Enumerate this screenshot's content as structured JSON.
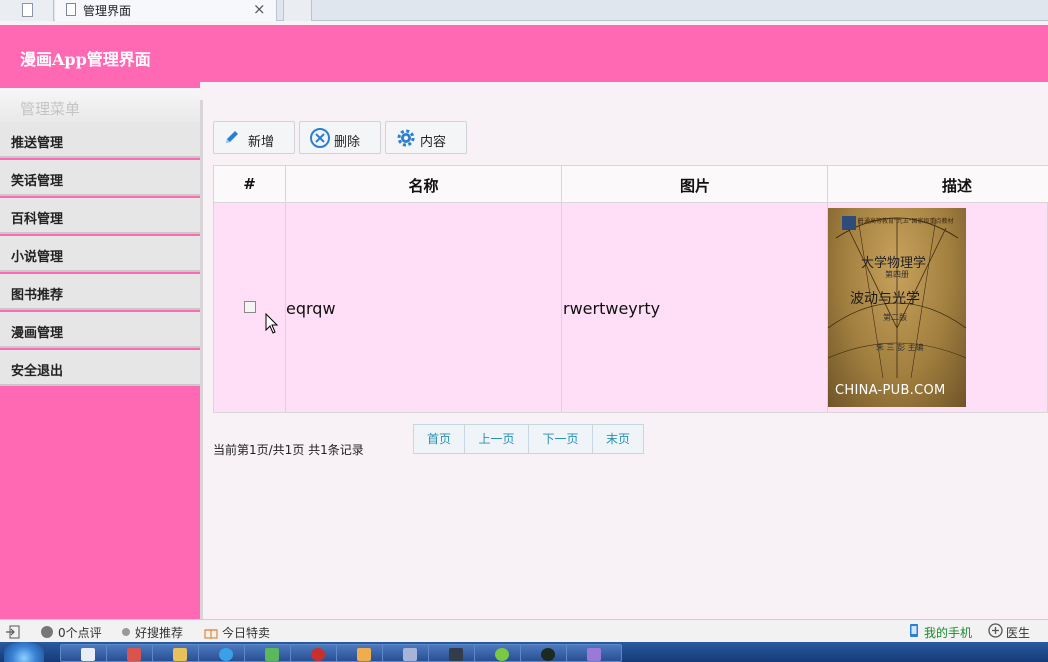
{
  "browser": {
    "tab_title": "管理界面",
    "close_glyph": "×"
  },
  "header": {
    "title": "漫画App管理界面"
  },
  "sidebar": {
    "heading": "管理菜单",
    "items": [
      {
        "label": "推送管理"
      },
      {
        "label": "笑话管理"
      },
      {
        "label": "百科管理"
      },
      {
        "label": "小说管理"
      },
      {
        "label": "图书推荐"
      },
      {
        "label": "漫画管理"
      },
      {
        "label": "安全退出"
      }
    ]
  },
  "toolbar": {
    "add_label": "新增",
    "delete_label": "删除",
    "content_label": "内容"
  },
  "table": {
    "columns": [
      "#",
      "名称",
      "图片",
      "描述"
    ],
    "rows": [
      {
        "name": "eqrqw",
        "image": "rwertweyrty"
      }
    ]
  },
  "book_cover": {
    "banner": "普通高等教育\"九五\"国家级重点教材",
    "title": "大学物理学",
    "volume": "第四册",
    "subtitle": "波动与光学",
    "edition": "第二版",
    "author": "朱 三 彭 主编",
    "watermark": "CHINA-PUB.COM"
  },
  "pager": {
    "info": "当前第1页/共1页 共1条记录",
    "first": "首页",
    "prev": "上一页",
    "next": "下一页",
    "last": "末页"
  },
  "statusbar": {
    "reviews": "0个点评",
    "recommend": "好搜推荐",
    "deals": "今日特卖",
    "my_phone": "我的手机",
    "doctor": "医生"
  },
  "colors": {
    "accent": "#ff69b4",
    "row_bg": "#ffdff7",
    "icon_blue": "#2a7fd4"
  }
}
